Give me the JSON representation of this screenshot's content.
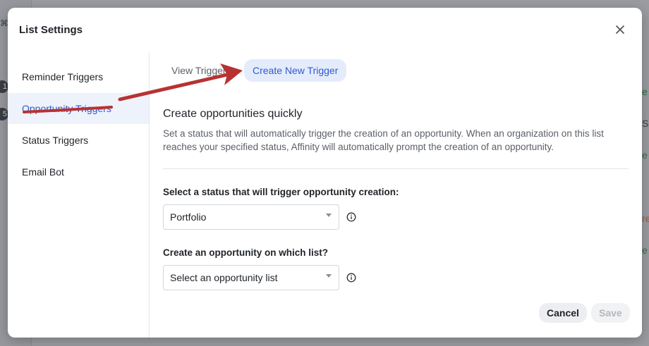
{
  "modal": {
    "title": "List Settings"
  },
  "sidebar": {
    "items": [
      {
        "label": "Reminder Triggers",
        "active": false
      },
      {
        "label": "Opportunity Triggers",
        "active": true
      },
      {
        "label": "Status Triggers",
        "active": false
      },
      {
        "label": "Email Bot",
        "active": false
      }
    ]
  },
  "tabs": {
    "view_label": "View Triggers",
    "create_label": "Create New Trigger"
  },
  "section": {
    "heading": "Create opportunities quickly",
    "description": "Set a status that will automatically trigger the creation of an opportunity. When an organization on this list reaches your specified status, Affinity will automatically prompt the creation of an opportunity."
  },
  "fields": {
    "status_label": "Select a status that will trigger opportunity creation:",
    "status_value": "Portfolio",
    "list_label": "Create an opportunity on which list?",
    "list_value": "Select an opportunity list"
  },
  "footer": {
    "cancel_label": "Cancel",
    "save_label": "Save"
  },
  "background": {
    "badge_1": "1",
    "badge_2": "5",
    "right_fragments": [
      "e",
      "Sa",
      "e",
      "re",
      "e"
    ]
  },
  "colors": {
    "accent": "#2f5bd3",
    "annotation_arrow": "#b83232"
  }
}
